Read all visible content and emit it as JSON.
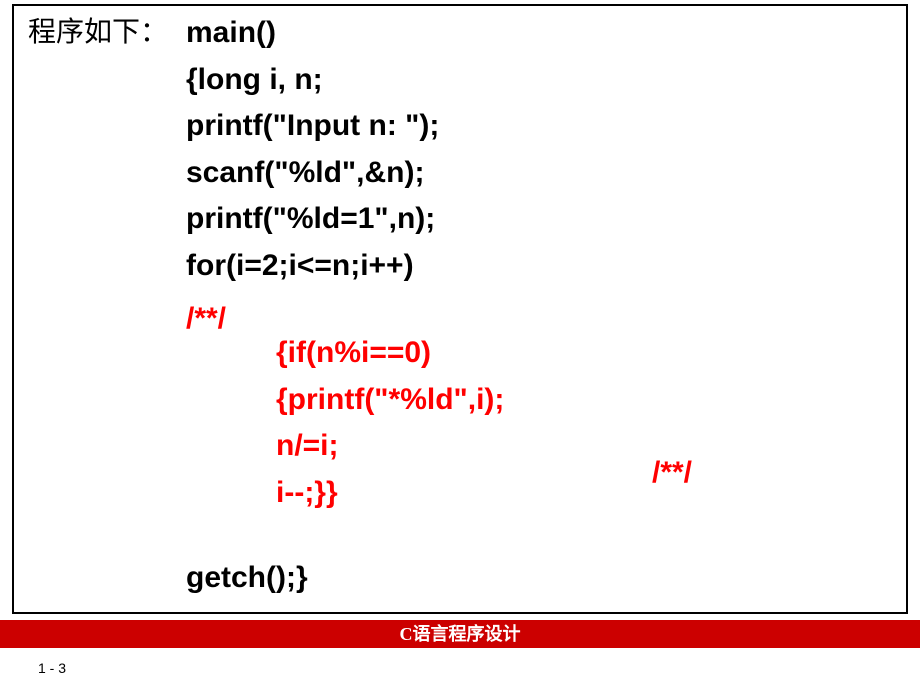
{
  "intro_label": "程序如下：",
  "code": {
    "line1": "main()",
    "line2": "{long i, n;",
    "line3": "printf(\"Input n: \");",
    "line4": "scanf(\"%ld\",&n);",
    "line5": "printf(\"%ld=1\",n);",
    "line6": "for(i=2;i<=n;i++)",
    "last": "getch();}"
  },
  "red": {
    "comment1": "/**/",
    "block_line1": "{if(n%i==0)",
    "block_line2": "{printf(\"*%ld\",i);",
    "block_line3": "n/=i;",
    "block_line4": "i--;}}",
    "comment2": "/**/"
  },
  "footer": {
    "bar_text": "C语言程序设计",
    "page_number": "1 - 3"
  }
}
